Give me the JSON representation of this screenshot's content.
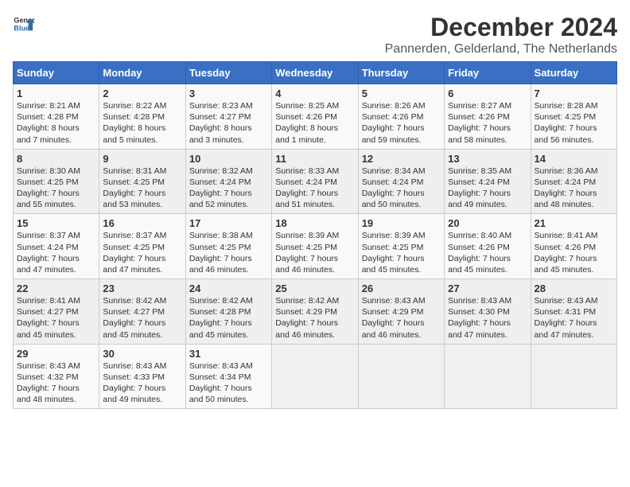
{
  "logo": {
    "line1": "General",
    "line2": "Blue"
  },
  "title": "December 2024",
  "subtitle": "Pannerden, Gelderland, The Netherlands",
  "days_of_week": [
    "Sunday",
    "Monday",
    "Tuesday",
    "Wednesday",
    "Thursday",
    "Friday",
    "Saturday"
  ],
  "weeks": [
    [
      {
        "day": "1",
        "text": "Sunrise: 8:21 AM\nSunset: 4:28 PM\nDaylight: 8 hours\nand 7 minutes."
      },
      {
        "day": "2",
        "text": "Sunrise: 8:22 AM\nSunset: 4:28 PM\nDaylight: 8 hours\nand 5 minutes."
      },
      {
        "day": "3",
        "text": "Sunrise: 8:23 AM\nSunset: 4:27 PM\nDaylight: 8 hours\nand 3 minutes."
      },
      {
        "day": "4",
        "text": "Sunrise: 8:25 AM\nSunset: 4:26 PM\nDaylight: 8 hours\nand 1 minute."
      },
      {
        "day": "5",
        "text": "Sunrise: 8:26 AM\nSunset: 4:26 PM\nDaylight: 7 hours\nand 59 minutes."
      },
      {
        "day": "6",
        "text": "Sunrise: 8:27 AM\nSunset: 4:26 PM\nDaylight: 7 hours\nand 58 minutes."
      },
      {
        "day": "7",
        "text": "Sunrise: 8:28 AM\nSunset: 4:25 PM\nDaylight: 7 hours\nand 56 minutes."
      }
    ],
    [
      {
        "day": "8",
        "text": "Sunrise: 8:30 AM\nSunset: 4:25 PM\nDaylight: 7 hours\nand 55 minutes."
      },
      {
        "day": "9",
        "text": "Sunrise: 8:31 AM\nSunset: 4:25 PM\nDaylight: 7 hours\nand 53 minutes."
      },
      {
        "day": "10",
        "text": "Sunrise: 8:32 AM\nSunset: 4:24 PM\nDaylight: 7 hours\nand 52 minutes."
      },
      {
        "day": "11",
        "text": "Sunrise: 8:33 AM\nSunset: 4:24 PM\nDaylight: 7 hours\nand 51 minutes."
      },
      {
        "day": "12",
        "text": "Sunrise: 8:34 AM\nSunset: 4:24 PM\nDaylight: 7 hours\nand 50 minutes."
      },
      {
        "day": "13",
        "text": "Sunrise: 8:35 AM\nSunset: 4:24 PM\nDaylight: 7 hours\nand 49 minutes."
      },
      {
        "day": "14",
        "text": "Sunrise: 8:36 AM\nSunset: 4:24 PM\nDaylight: 7 hours\nand 48 minutes."
      }
    ],
    [
      {
        "day": "15",
        "text": "Sunrise: 8:37 AM\nSunset: 4:24 PM\nDaylight: 7 hours\nand 47 minutes."
      },
      {
        "day": "16",
        "text": "Sunrise: 8:37 AM\nSunset: 4:25 PM\nDaylight: 7 hours\nand 47 minutes."
      },
      {
        "day": "17",
        "text": "Sunrise: 8:38 AM\nSunset: 4:25 PM\nDaylight: 7 hours\nand 46 minutes."
      },
      {
        "day": "18",
        "text": "Sunrise: 8:39 AM\nSunset: 4:25 PM\nDaylight: 7 hours\nand 46 minutes."
      },
      {
        "day": "19",
        "text": "Sunrise: 8:39 AM\nSunset: 4:25 PM\nDaylight: 7 hours\nand 45 minutes."
      },
      {
        "day": "20",
        "text": "Sunrise: 8:40 AM\nSunset: 4:26 PM\nDaylight: 7 hours\nand 45 minutes."
      },
      {
        "day": "21",
        "text": "Sunrise: 8:41 AM\nSunset: 4:26 PM\nDaylight: 7 hours\nand 45 minutes."
      }
    ],
    [
      {
        "day": "22",
        "text": "Sunrise: 8:41 AM\nSunset: 4:27 PM\nDaylight: 7 hours\nand 45 minutes."
      },
      {
        "day": "23",
        "text": "Sunrise: 8:42 AM\nSunset: 4:27 PM\nDaylight: 7 hours\nand 45 minutes."
      },
      {
        "day": "24",
        "text": "Sunrise: 8:42 AM\nSunset: 4:28 PM\nDaylight: 7 hours\nand 45 minutes."
      },
      {
        "day": "25",
        "text": "Sunrise: 8:42 AM\nSunset: 4:29 PM\nDaylight: 7 hours\nand 46 minutes."
      },
      {
        "day": "26",
        "text": "Sunrise: 8:43 AM\nSunset: 4:29 PM\nDaylight: 7 hours\nand 46 minutes."
      },
      {
        "day": "27",
        "text": "Sunrise: 8:43 AM\nSunset: 4:30 PM\nDaylight: 7 hours\nand 47 minutes."
      },
      {
        "day": "28",
        "text": "Sunrise: 8:43 AM\nSunset: 4:31 PM\nDaylight: 7 hours\nand 47 minutes."
      }
    ],
    [
      {
        "day": "29",
        "text": "Sunrise: 8:43 AM\nSunset: 4:32 PM\nDaylight: 7 hours\nand 48 minutes."
      },
      {
        "day": "30",
        "text": "Sunrise: 8:43 AM\nSunset: 4:33 PM\nDaylight: 7 hours\nand 49 minutes."
      },
      {
        "day": "31",
        "text": "Sunrise: 8:43 AM\nSunset: 4:34 PM\nDaylight: 7 hours\nand 50 minutes."
      },
      {
        "day": "",
        "text": ""
      },
      {
        "day": "",
        "text": ""
      },
      {
        "day": "",
        "text": ""
      },
      {
        "day": "",
        "text": ""
      }
    ]
  ]
}
